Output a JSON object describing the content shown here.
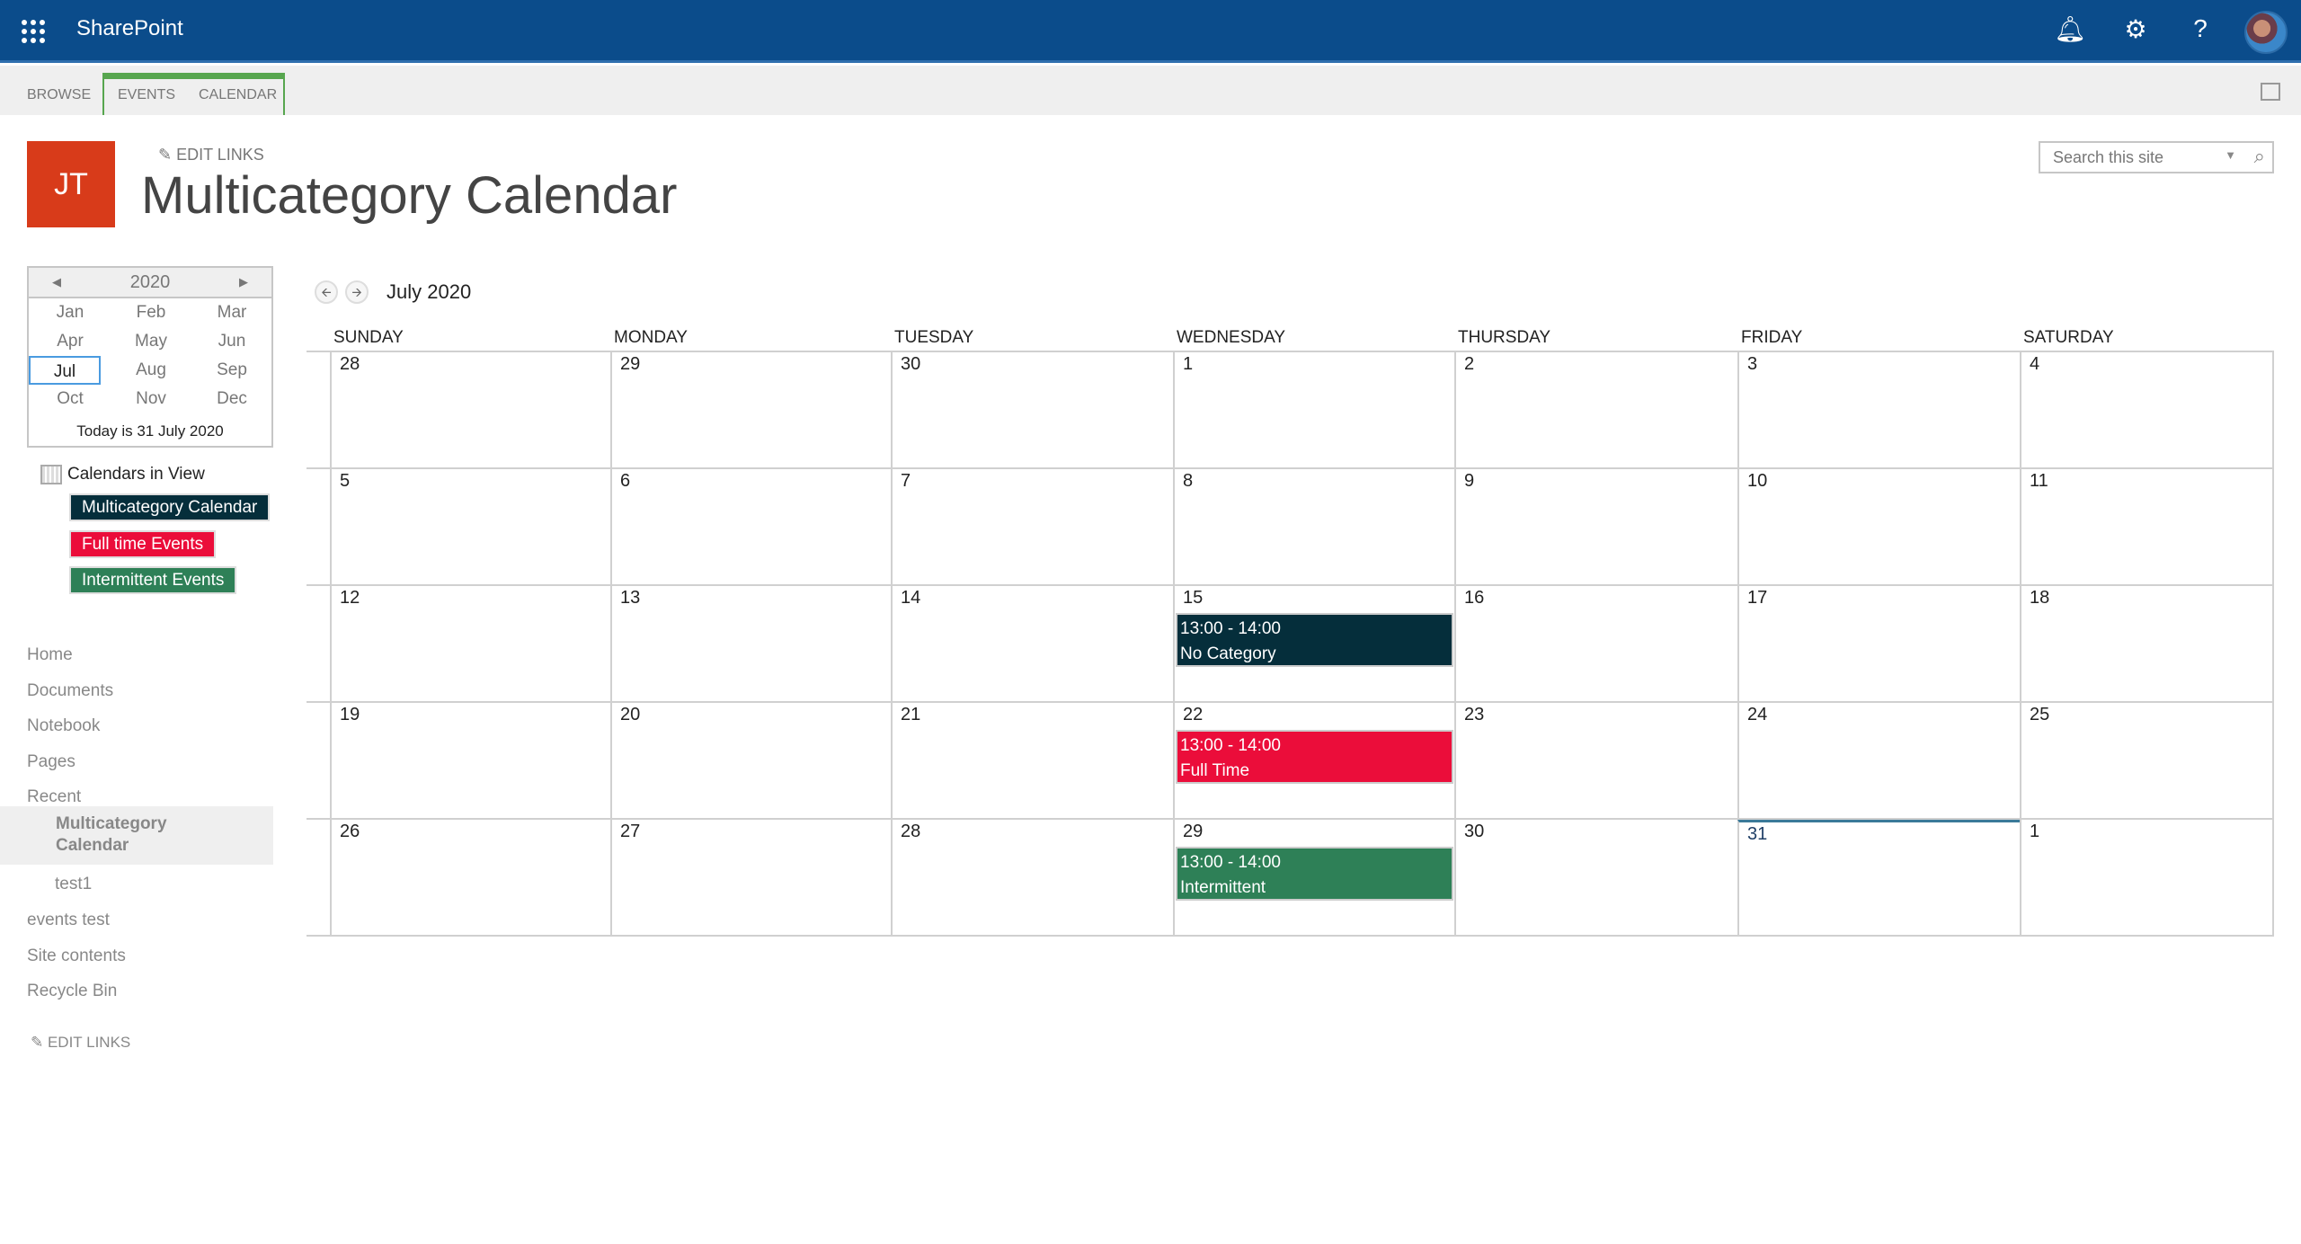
{
  "app": {
    "brand": "SharePoint",
    "icons": [
      "app-launcher-icon",
      "bell-icon",
      "gear-icon",
      "help-icon",
      "avatar"
    ]
  },
  "ribbon": {
    "tabs": [
      "BROWSE",
      "EVENTS",
      "CALENDAR"
    ]
  },
  "site": {
    "logo_text": "JT",
    "edit_links": "EDIT LINKS",
    "title": "Multicategory Calendar",
    "logo_color": "#d83b1a"
  },
  "search": {
    "placeholder": "Search this site"
  },
  "mini_calendar": {
    "year": "2020",
    "months": [
      "Jan",
      "Feb",
      "Mar",
      "Apr",
      "May",
      "Jun",
      "Jul",
      "Aug",
      "Sep",
      "Oct",
      "Nov",
      "Dec"
    ],
    "selected": "Jul",
    "today_text": "Today is 31 July 2020"
  },
  "calendars_in_view": {
    "label": "Calendars in View",
    "items": [
      {
        "label": "Multicategory Calendar",
        "color": "#052e3b"
      },
      {
        "label": "Full time Events",
        "color": "#eb0d3a"
      },
      {
        "label": "Intermittent Events",
        "color": "#2e8057"
      }
    ]
  },
  "nav": {
    "items": [
      "Home",
      "Documents",
      "Notebook",
      "Pages",
      "Recent"
    ],
    "recent": [
      "Multicategory Calendar",
      "test1"
    ],
    "selected": "Multicategory Calendar",
    "items_after": [
      "events test",
      "Site contents",
      "Recycle Bin"
    ],
    "edit_links": "EDIT LINKS"
  },
  "calendar": {
    "month_title": "July 2020",
    "days": [
      "SUNDAY",
      "MONDAY",
      "TUESDAY",
      "WEDNESDAY",
      "THURSDAY",
      "FRIDAY",
      "SATURDAY"
    ],
    "weeks": [
      [
        "28",
        "29",
        "30",
        "1",
        "2",
        "3",
        "4"
      ],
      [
        "5",
        "6",
        "7",
        "8",
        "9",
        "10",
        "11"
      ],
      [
        "12",
        "13",
        "14",
        "15",
        "16",
        "17",
        "18"
      ],
      [
        "19",
        "20",
        "21",
        "22",
        "23",
        "24",
        "25"
      ],
      [
        "26",
        "27",
        "28",
        "29",
        "30",
        "31",
        "1"
      ]
    ],
    "today": "31",
    "events": [
      {
        "day": "15",
        "time": "13:00 - 14:00",
        "title": "No Category",
        "color": "#052e3b"
      },
      {
        "day": "22",
        "time": "13:00 - 14:00",
        "title": "Full Time",
        "color": "#eb0d3a"
      },
      {
        "day": "29",
        "time": "13:00 - 14:00",
        "title": "Intermittent",
        "color": "#2e8057"
      }
    ]
  }
}
